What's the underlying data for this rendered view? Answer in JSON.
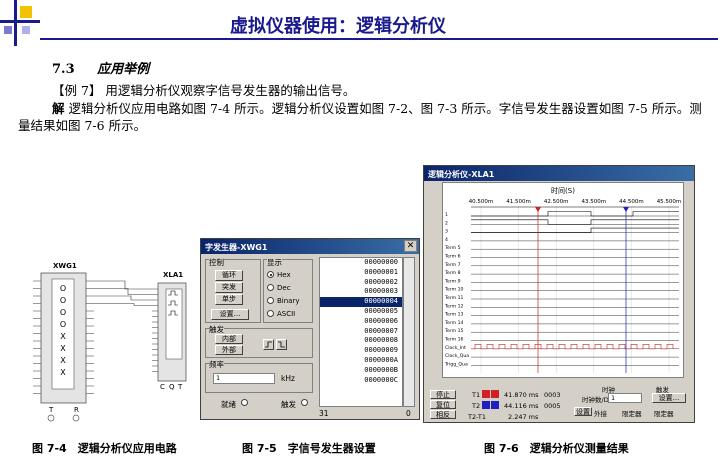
{
  "header": {
    "title": "虚拟仪器使用：逻辑分析仪"
  },
  "section": {
    "number": "7.3",
    "title": "应用举例"
  },
  "example": {
    "label": "【例 7】",
    "text": "用逻辑分析仪观察字信号发生器的输出信号。",
    "solution_label": "解",
    "solution_text": "逻辑分析仪应用电路如图 7-4 所示。逻辑分析仪设置如图 7-2、图 7-3 所示。字信号发生器设置如图 7-5 所示。测量结果如图 7-6 所示。"
  },
  "circuit": {
    "wg_label": "XWG1",
    "la_label": "XLA1",
    "wg_pins_bottom": [
      "T",
      "R"
    ],
    "la_pins_bottom": [
      "C",
      "Q",
      "T"
    ],
    "wg_marks": [
      "O",
      "O",
      "O",
      "O",
      "X",
      "X",
      "X",
      "X"
    ]
  },
  "word_generator": {
    "title": "字发生器-XWG1",
    "close": "✕",
    "control_label": "控制",
    "btn_cycle": "循环",
    "btn_burst": "突发",
    "btn_step": "单步",
    "btn_setup": "设置...",
    "display_label": "显示",
    "display_options": [
      "Hex",
      "Dec",
      "Binary",
      "ASCII"
    ],
    "trigger_label": "触发",
    "btn_internal": "内部",
    "btn_external": "外部",
    "freq_label": "频率",
    "freq_value": "1",
    "freq_unit": "kHz",
    "ready_label": "就绪",
    "trigger_status_label": "触发",
    "list_start": "31",
    "list_end": "0",
    "words": [
      "00000000",
      "00000001",
      "00000002",
      "00000003",
      "00000004",
      "00000005",
      "00000006",
      "00000007",
      "00000008",
      "00000009",
      "0000000A",
      "0000000B",
      "0000000C"
    ],
    "selected_index": 4
  },
  "logic_analyzer": {
    "title": "逻辑分析仪-XLA1",
    "time_label": "时间(S)",
    "time_ticks": [
      "40.500m",
      "41.500m",
      "42.500m",
      "43.500m",
      "44.500m",
      "45.500m"
    ],
    "channels": [
      "1",
      "2",
      "3",
      "4",
      "Term 5",
      "Term 6",
      "Term 7",
      "Term 8",
      "Term 9",
      "Term 10",
      "Term 11",
      "Term 12",
      "Term 13",
      "Term 14",
      "Term 15",
      "Term 16",
      "Clock_Int",
      "Clock_Qua",
      "Trigg_Qua"
    ],
    "btn_stop": "停止",
    "btn_reset": "复位",
    "btn_reverse": "相反",
    "t1_label": "T1",
    "t2_label": "T2",
    "t2t1_label": "T2-T1",
    "t1_time": "41.870 ms",
    "t2_time": "44.116 ms",
    "dt_time": "2.247 ms",
    "t1_value": "0003",
    "t2_value": "0005",
    "clock_label": "时钟",
    "clock_div_label": "时钟数/Div",
    "clock_div_value": "1",
    "btn_clock_setup": "设置",
    "clock_external": "外接",
    "clock_qualifier": "限定器",
    "trigger_label": "触发",
    "btn_trigger_setup": "设置...",
    "trigger_qualifier": "限定器"
  },
  "captions": {
    "fig4": "图 7-4　逻辑分析仪应用电路",
    "fig5": "图 7-5　字信号发生器设置",
    "fig6": "图 7-6　逻辑分析仪测量结果"
  },
  "colors": {
    "title": "#1a1a8c",
    "titlebar": "#0a246a",
    "cursor1": "#d02020",
    "cursor2": "#2020c0",
    "wave": "#000000",
    "clock": "#d02020"
  }
}
